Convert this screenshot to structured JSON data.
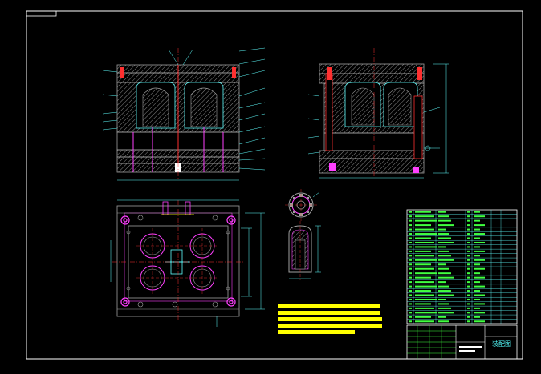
{
  "drawing": {
    "title_block_text": "装配图",
    "technical_requirements_title": "技术要求",
    "colors": {
      "background": "#000000",
      "frame": "#ffffff",
      "outline": "#5fffff",
      "plate": "#a0a0a0",
      "magenta": "#ff40ff",
      "red": "#ff3030",
      "yellow": "#ffff00",
      "green": "#40ff40",
      "hatch": "#7f7f7f"
    }
  }
}
